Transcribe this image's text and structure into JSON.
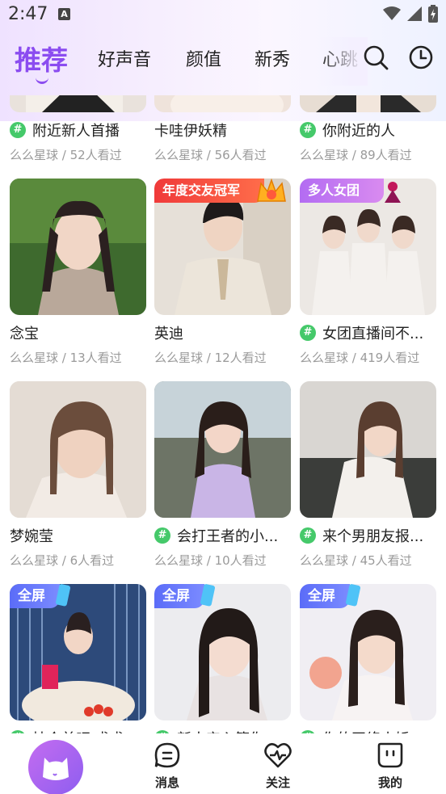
{
  "status_bar": {
    "time": "2:47",
    "notif_letter": "A"
  },
  "tabs": [
    {
      "label": "推荐",
      "active": true
    },
    {
      "label": "好声音"
    },
    {
      "label": "颜值"
    },
    {
      "label": "新秀"
    },
    {
      "label": "心跳"
    }
  ],
  "top_icons": [
    "search-icon",
    "history-clock-icon"
  ],
  "cards": [
    {
      "title": "附近新人首播",
      "sub": "么么星球 / 52人看过",
      "hash": true
    },
    {
      "title": "卡哇伊妖精",
      "sub": "么么星球 / 56人看过",
      "hash": false
    },
    {
      "title": "你附近的人",
      "sub": "么么星球 / 89人看过",
      "hash": true
    },
    {
      "title": "念宝",
      "sub": "么么星球 / 13人看过",
      "hash": false
    },
    {
      "title": "英迪",
      "sub": "么么星球 / 12人看过",
      "hash": false,
      "badge": "年度交友冠军"
    },
    {
      "title": "女团直播间不...",
      "sub": "么么星球 / 419人看过",
      "hash": true,
      "badge": "多人女团"
    },
    {
      "title": "梦婉莹",
      "sub": "么么星球 / 6人看过",
      "hash": false
    },
    {
      "title": "会打王者的小...",
      "sub": "么么星球 / 10人看过",
      "hash": true
    },
    {
      "title": "来个男朋友报...",
      "sub": "么么星球 / 45人看过",
      "hash": true
    },
    {
      "title": "扶个首吧 求求",
      "sub": "",
      "hash": true,
      "badge": "全屏"
    },
    {
      "title": "新人安心等你",
      "sub": "",
      "hash": true,
      "badge": "全屏"
    },
    {
      "title": "你的网络小娇",
      "sub": "",
      "hash": true,
      "badge": "全屏"
    }
  ],
  "bottom_nav": [
    {
      "label": "",
      "icon": "home-cat-icon"
    },
    {
      "label": "消息",
      "icon": "message-icon"
    },
    {
      "label": "关注",
      "icon": "heart-pulse-icon"
    },
    {
      "label": "我的",
      "icon": "profile-face-icon"
    }
  ],
  "colors": {
    "accent": "#8b4cf0",
    "hash_green": "#45c96a",
    "badge_red": "#f03a3a",
    "badge_purple": "#b36cf2",
    "badge_blue": "#5b6cf8"
  }
}
